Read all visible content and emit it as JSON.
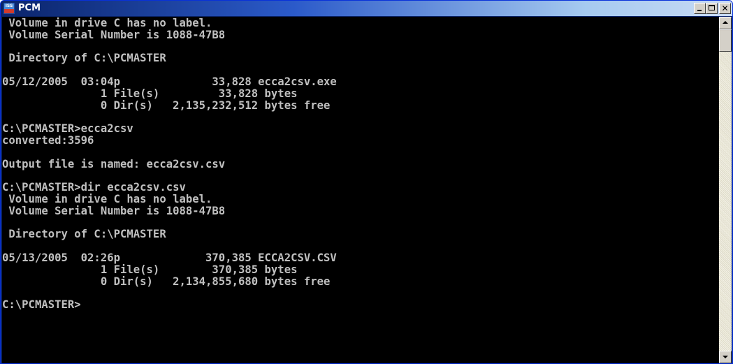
{
  "window": {
    "title": "PCM",
    "icon": "iss-app-icon",
    "icon_text": "ISS",
    "close_glyph": "✕",
    "scroll_position": 0.0
  },
  "console": {
    "text_color": "#c0c0c0",
    "background": "#000000",
    "lines": [
      " Volume in drive C has no label.",
      " Volume Serial Number is 1088-47B8",
      "",
      " Directory of C:\\PCMASTER",
      "",
      "05/12/2005  03:04p              33,828 ecca2csv.exe",
      "               1 File(s)         33,828 bytes",
      "               0 Dir(s)   2,135,232,512 bytes free",
      "",
      "C:\\PCMASTER>ecca2csv",
      "converted:3596",
      "",
      "Output file is named: ecca2csv.csv",
      "",
      "C:\\PCMASTER>dir ecca2csv.csv",
      " Volume in drive C has no label.",
      " Volume Serial Number is 1088-47B8",
      "",
      " Directory of C:\\PCMASTER",
      "",
      "05/13/2005  02:26p             370,385 ECCA2CSV.CSV",
      "               1 File(s)        370,385 bytes",
      "               0 Dir(s)   2,134,855,680 bytes free",
      "",
      "C:\\PCMASTER>"
    ]
  }
}
